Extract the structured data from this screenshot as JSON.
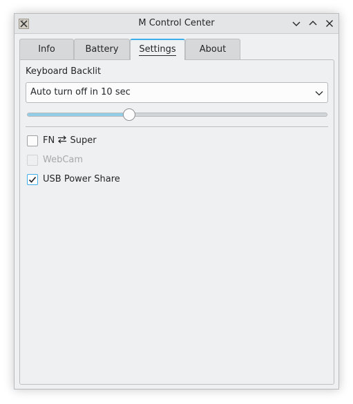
{
  "window": {
    "title": "M Control Center"
  },
  "tabs": [
    {
      "label": "Info",
      "active": false
    },
    {
      "label": "Battery",
      "active": false
    },
    {
      "label": "Settings",
      "active": true
    },
    {
      "label": "About",
      "active": false
    }
  ],
  "settings": {
    "keyboard_backlit_label": "Keyboard Backlit",
    "backlit_mode": "Auto turn off in 10 sec",
    "brightness_fraction": 0.34,
    "options": [
      {
        "label": "FN",
        "label_suffix": "Super",
        "icon": "swap-arrows-icon",
        "checked": false,
        "enabled": true
      },
      {
        "label": "WebCam",
        "checked": false,
        "enabled": false
      },
      {
        "label": "USB Power Share",
        "checked": true,
        "enabled": true
      }
    ]
  },
  "colors": {
    "accent": "#3daee9",
    "slider_fill": "#93cee9",
    "window_bg": "#eff0f1"
  }
}
